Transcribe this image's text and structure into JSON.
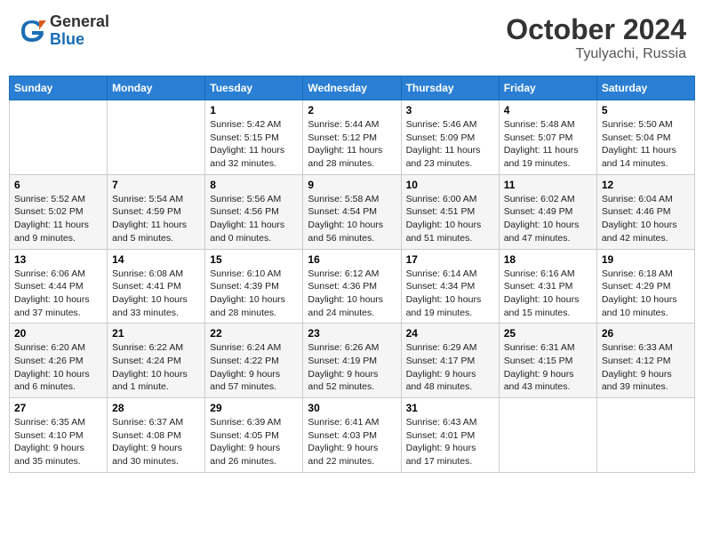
{
  "header": {
    "logo_line1": "General",
    "logo_line2": "Blue",
    "month": "October 2024",
    "location": "Tyulyachi, Russia"
  },
  "weekdays": [
    "Sunday",
    "Monday",
    "Tuesday",
    "Wednesday",
    "Thursday",
    "Friday",
    "Saturday"
  ],
  "weeks": [
    [
      {
        "day": "",
        "sunrise": "",
        "sunset": "",
        "daylight": ""
      },
      {
        "day": "",
        "sunrise": "",
        "sunset": "",
        "daylight": ""
      },
      {
        "day": "1",
        "sunrise": "Sunrise: 5:42 AM",
        "sunset": "Sunset: 5:15 PM",
        "daylight": "Daylight: 11 hours and 32 minutes."
      },
      {
        "day": "2",
        "sunrise": "Sunrise: 5:44 AM",
        "sunset": "Sunset: 5:12 PM",
        "daylight": "Daylight: 11 hours and 28 minutes."
      },
      {
        "day": "3",
        "sunrise": "Sunrise: 5:46 AM",
        "sunset": "Sunset: 5:09 PM",
        "daylight": "Daylight: 11 hours and 23 minutes."
      },
      {
        "day": "4",
        "sunrise": "Sunrise: 5:48 AM",
        "sunset": "Sunset: 5:07 PM",
        "daylight": "Daylight: 11 hours and 19 minutes."
      },
      {
        "day": "5",
        "sunrise": "Sunrise: 5:50 AM",
        "sunset": "Sunset: 5:04 PM",
        "daylight": "Daylight: 11 hours and 14 minutes."
      }
    ],
    [
      {
        "day": "6",
        "sunrise": "Sunrise: 5:52 AM",
        "sunset": "Sunset: 5:02 PM",
        "daylight": "Daylight: 11 hours and 9 minutes."
      },
      {
        "day": "7",
        "sunrise": "Sunrise: 5:54 AM",
        "sunset": "Sunset: 4:59 PM",
        "daylight": "Daylight: 11 hours and 5 minutes."
      },
      {
        "day": "8",
        "sunrise": "Sunrise: 5:56 AM",
        "sunset": "Sunset: 4:56 PM",
        "daylight": "Daylight: 11 hours and 0 minutes."
      },
      {
        "day": "9",
        "sunrise": "Sunrise: 5:58 AM",
        "sunset": "Sunset: 4:54 PM",
        "daylight": "Daylight: 10 hours and 56 minutes."
      },
      {
        "day": "10",
        "sunrise": "Sunrise: 6:00 AM",
        "sunset": "Sunset: 4:51 PM",
        "daylight": "Daylight: 10 hours and 51 minutes."
      },
      {
        "day": "11",
        "sunrise": "Sunrise: 6:02 AM",
        "sunset": "Sunset: 4:49 PM",
        "daylight": "Daylight: 10 hours and 47 minutes."
      },
      {
        "day": "12",
        "sunrise": "Sunrise: 6:04 AM",
        "sunset": "Sunset: 4:46 PM",
        "daylight": "Daylight: 10 hours and 42 minutes."
      }
    ],
    [
      {
        "day": "13",
        "sunrise": "Sunrise: 6:06 AM",
        "sunset": "Sunset: 4:44 PM",
        "daylight": "Daylight: 10 hours and 37 minutes."
      },
      {
        "day": "14",
        "sunrise": "Sunrise: 6:08 AM",
        "sunset": "Sunset: 4:41 PM",
        "daylight": "Daylight: 10 hours and 33 minutes."
      },
      {
        "day": "15",
        "sunrise": "Sunrise: 6:10 AM",
        "sunset": "Sunset: 4:39 PM",
        "daylight": "Daylight: 10 hours and 28 minutes."
      },
      {
        "day": "16",
        "sunrise": "Sunrise: 6:12 AM",
        "sunset": "Sunset: 4:36 PM",
        "daylight": "Daylight: 10 hours and 24 minutes."
      },
      {
        "day": "17",
        "sunrise": "Sunrise: 6:14 AM",
        "sunset": "Sunset: 4:34 PM",
        "daylight": "Daylight: 10 hours and 19 minutes."
      },
      {
        "day": "18",
        "sunrise": "Sunrise: 6:16 AM",
        "sunset": "Sunset: 4:31 PM",
        "daylight": "Daylight: 10 hours and 15 minutes."
      },
      {
        "day": "19",
        "sunrise": "Sunrise: 6:18 AM",
        "sunset": "Sunset: 4:29 PM",
        "daylight": "Daylight: 10 hours and 10 minutes."
      }
    ],
    [
      {
        "day": "20",
        "sunrise": "Sunrise: 6:20 AM",
        "sunset": "Sunset: 4:26 PM",
        "daylight": "Daylight: 10 hours and 6 minutes."
      },
      {
        "day": "21",
        "sunrise": "Sunrise: 6:22 AM",
        "sunset": "Sunset: 4:24 PM",
        "daylight": "Daylight: 10 hours and 1 minute."
      },
      {
        "day": "22",
        "sunrise": "Sunrise: 6:24 AM",
        "sunset": "Sunset: 4:22 PM",
        "daylight": "Daylight: 9 hours and 57 minutes."
      },
      {
        "day": "23",
        "sunrise": "Sunrise: 6:26 AM",
        "sunset": "Sunset: 4:19 PM",
        "daylight": "Daylight: 9 hours and 52 minutes."
      },
      {
        "day": "24",
        "sunrise": "Sunrise: 6:29 AM",
        "sunset": "Sunset: 4:17 PM",
        "daylight": "Daylight: 9 hours and 48 minutes."
      },
      {
        "day": "25",
        "sunrise": "Sunrise: 6:31 AM",
        "sunset": "Sunset: 4:15 PM",
        "daylight": "Daylight: 9 hours and 43 minutes."
      },
      {
        "day": "26",
        "sunrise": "Sunrise: 6:33 AM",
        "sunset": "Sunset: 4:12 PM",
        "daylight": "Daylight: 9 hours and 39 minutes."
      }
    ],
    [
      {
        "day": "27",
        "sunrise": "Sunrise: 6:35 AM",
        "sunset": "Sunset: 4:10 PM",
        "daylight": "Daylight: 9 hours and 35 minutes."
      },
      {
        "day": "28",
        "sunrise": "Sunrise: 6:37 AM",
        "sunset": "Sunset: 4:08 PM",
        "daylight": "Daylight: 9 hours and 30 minutes."
      },
      {
        "day": "29",
        "sunrise": "Sunrise: 6:39 AM",
        "sunset": "Sunset: 4:05 PM",
        "daylight": "Daylight: 9 hours and 26 minutes."
      },
      {
        "day": "30",
        "sunrise": "Sunrise: 6:41 AM",
        "sunset": "Sunset: 4:03 PM",
        "daylight": "Daylight: 9 hours and 22 minutes."
      },
      {
        "day": "31",
        "sunrise": "Sunrise: 6:43 AM",
        "sunset": "Sunset: 4:01 PM",
        "daylight": "Daylight: 9 hours and 17 minutes."
      },
      {
        "day": "",
        "sunrise": "",
        "sunset": "",
        "daylight": ""
      },
      {
        "day": "",
        "sunrise": "",
        "sunset": "",
        "daylight": ""
      }
    ]
  ]
}
